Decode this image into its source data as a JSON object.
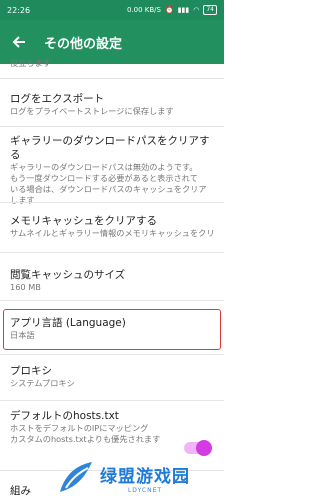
{
  "status": {
    "time": "22:26",
    "net": "0.00 KB/S",
    "battery": "74"
  },
  "appbar": {
    "title": "その他の設定"
  },
  "items": [
    {
      "subtitle": "役立ちます"
    },
    {
      "title": "ログをエクスポート",
      "subtitle": "ログをプライベートストレージに保存します"
    },
    {
      "title": "ギャラリーのダウンロードパスをクリアする",
      "subtitle_lines": [
        "ギャラリーのダウンロードパスは無効のようです。",
        "もう一度ダウンロードする必要があると表示されて",
        "いる場合は、ダウンロードパスのキャッシュをクリア",
        "します"
      ]
    },
    {
      "title": "メモリキャッシュをクリアする",
      "subtitle": "サムネイルとギャラリー情報のメモリキャッシュをクリア"
    },
    {
      "title": "閲覧キャッシュのサイズ",
      "subtitle": "160 MB"
    },
    {
      "title": "アプリ言語 (Language)",
      "subtitle": "日本語"
    },
    {
      "title": "プロキシ",
      "subtitle": "システムプロキシ"
    },
    {
      "title": "デフォルトのhosts.txt",
      "subtitle_lines": [
        "ホストをデフォルトのIPにマッピング",
        "カスタムのhosts.txtよりも優先されます"
      ],
      "toggle_on": true
    },
    {
      "title": "組み"
    }
  ],
  "watermark": {
    "main": "绿盟游戏园",
    "sub": "LDYCNET"
  },
  "colors": {
    "accent": "#22915f",
    "highlight": "#e23a3a",
    "toggle": "#d43be2"
  }
}
